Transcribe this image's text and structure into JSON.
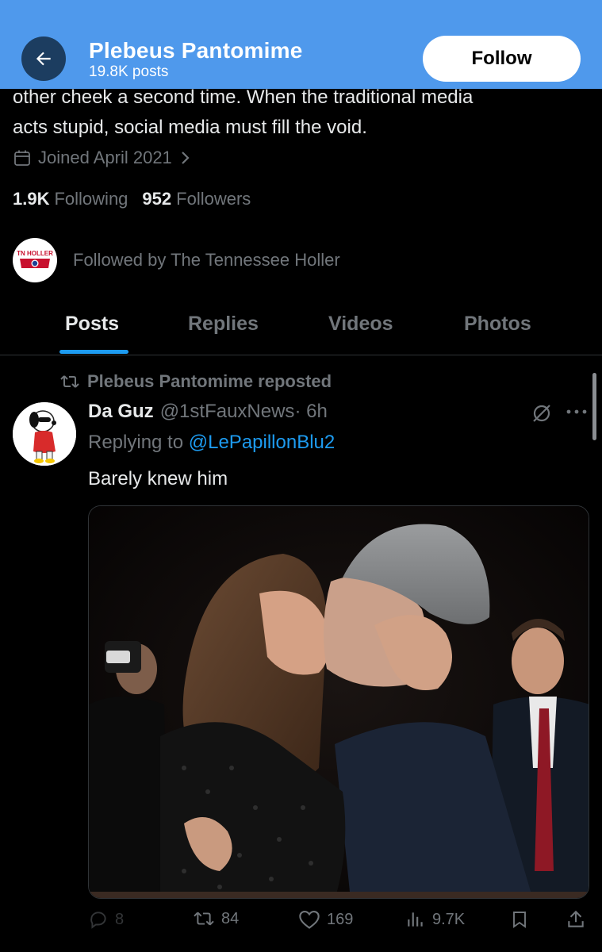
{
  "header": {
    "name": "Plebeus Pantomime",
    "post_count": "19.8K posts",
    "follow_label": "Follow"
  },
  "profile": {
    "bio_line1": "other cheek a second time. When the traditional media",
    "bio_line2": "acts stupid, social media must fill the void.",
    "joined": "Joined April 2021",
    "following_count": "1.9K",
    "following_label": "Following",
    "followers_count": "952",
    "followers_label": "Followers",
    "followed_by": "Followed by The Tennessee Holler",
    "followed_by_logo_text": "TN HOLLER"
  },
  "tabs": [
    {
      "label": "Posts",
      "active": true
    },
    {
      "label": "Replies",
      "active": false
    },
    {
      "label": "Videos",
      "active": false
    },
    {
      "label": "Photos",
      "active": false
    }
  ],
  "post": {
    "repost_text": "Plebeus Pantomime reposted",
    "author_name": "Da Guz",
    "author_handle": "@1stFauxNews",
    "time": "· 6h",
    "replying_prefix": "Replying to",
    "replying_to": "@LePapillonBlu2",
    "text": "Barely knew him",
    "actions": {
      "replies": "8",
      "reposts": "84",
      "likes": "169",
      "views": "9.7K"
    }
  },
  "colors": {
    "header_bg": "#4f99ec",
    "accent": "#1d9bf0",
    "muted_text": "#71767b",
    "primary_text": "#e7e9ea",
    "background": "#000000"
  },
  "icons": [
    "back-arrow-icon",
    "calendar-icon",
    "chevron-right-icon",
    "repost-icon",
    "grok-icon",
    "more-icon",
    "reply-icon",
    "like-icon",
    "views-icon",
    "bookmark-icon",
    "share-icon"
  ]
}
